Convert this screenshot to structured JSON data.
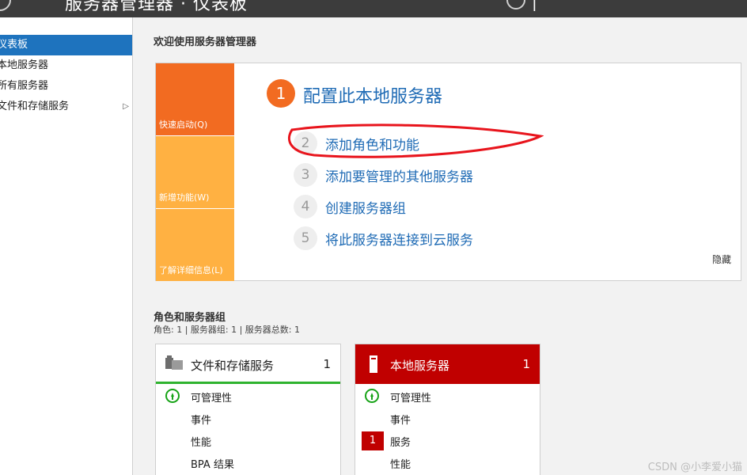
{
  "titlebar": {
    "title": "服务器管理器 · 仪表板"
  },
  "sidebar": {
    "items": [
      {
        "label": "仪表板",
        "active": true
      },
      {
        "label": "本地服务器"
      },
      {
        "label": "所有服务器"
      },
      {
        "label": "文件和存储服务",
        "has_arrow": true
      }
    ],
    "arrow_glyph": "▷"
  },
  "welcome": {
    "title": "欢迎使用服务器管理器",
    "tiles": [
      {
        "label": "快速启动(Q)",
        "color": "#f26b21"
      },
      {
        "label": "新增功能(W)",
        "color": "#ffb142"
      },
      {
        "label": "了解详细信息(L)",
        "color": "#ffb142"
      }
    ],
    "main_step": {
      "number": "1",
      "label": "配置此本地服务器"
    },
    "steps": [
      {
        "number": "2",
        "label": "添加角色和功能"
      },
      {
        "number": "3",
        "label": "添加要管理的其他服务器"
      },
      {
        "number": "4",
        "label": "创建服务器组"
      },
      {
        "number": "5",
        "label": "将此服务器连接到云服务"
      }
    ],
    "hide_label": "隐藏"
  },
  "roles": {
    "title": "角色和服务器组",
    "summary": "角色: 1 | 服务器组: 1 | 服务器总数: 1",
    "cards": [
      {
        "title": "文件和存储服务",
        "count": "1",
        "rows": [
          "可管理性",
          "事件",
          "性能",
          "BPA 结果"
        ]
      },
      {
        "title": "本地服务器",
        "count": "1",
        "rows": [
          "可管理性",
          "事件",
          "服务",
          "性能"
        ],
        "service_badge": "1"
      }
    ]
  },
  "colors": {
    "accent_blue": "#1e73be",
    "link_blue": "#1f6bb5",
    "orange": "#f26b21",
    "light_orange": "#ffb142",
    "red": "#c00000",
    "green": "#17a317",
    "annotation_red": "#e8141c"
  },
  "watermark": "CSDN @小李爱小猫"
}
